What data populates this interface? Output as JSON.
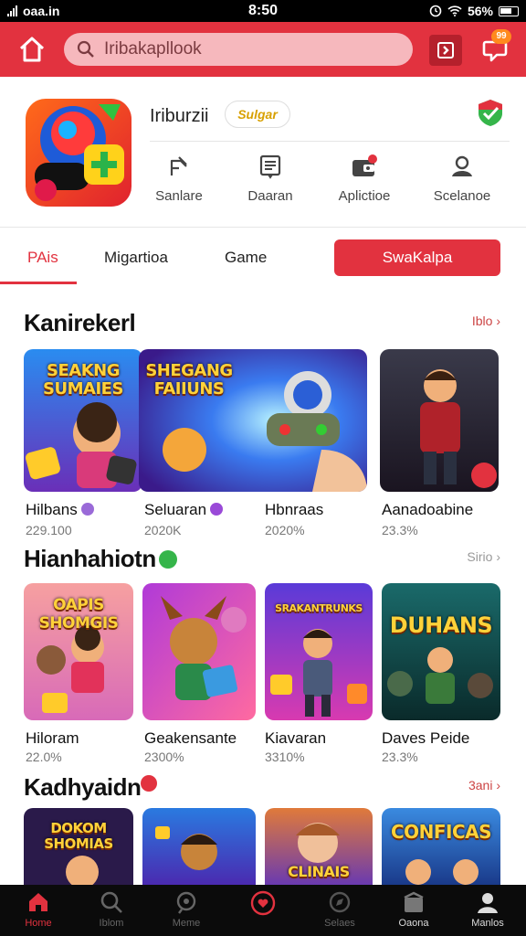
{
  "status_bar": {
    "carrier": "oaa.in",
    "time": "8:50",
    "battery": "56%"
  },
  "app_bar": {
    "search_placeholder": "Iribakapllook",
    "notification_count": "99"
  },
  "app_header": {
    "name": "Iriburzii",
    "badge": "Sulgar",
    "quick_actions": [
      {
        "label": "Sanlare",
        "icon": "share-icon"
      },
      {
        "label": "Daaran",
        "icon": "document-icon"
      },
      {
        "label": "Aplictioe",
        "icon": "wallet-icon"
      },
      {
        "label": "Scelanoe",
        "icon": "profile-icon"
      }
    ]
  },
  "tabs": {
    "items": [
      "PAis",
      "Migartioa",
      "Game"
    ],
    "active_index": 0,
    "subscribe_label": "SwaKalpa"
  },
  "sections": [
    {
      "title": "Kanirekerl",
      "link": "Iblo",
      "cards": [
        {
          "title": "Hilbans",
          "meta": "229.100",
          "cover": "SEAKNG SUMAIES",
          "verified": true
        },
        {
          "title": "Seluaran",
          "meta": "2020K",
          "cover": "SHEGANG FAIIUNS",
          "verified": true
        },
        {
          "title": "Hbnraas",
          "meta": "2020%",
          "cover": "",
          "verified": false
        },
        {
          "title": "Aanadoabine",
          "meta": "23.3%",
          "cover": "",
          "verified": false
        }
      ]
    },
    {
      "title": "Hianhahiotn",
      "link": "Sirio",
      "cards": [
        {
          "title": "Hiloram",
          "meta": "22.0%",
          "cover": "OAPIS SHOMGIS"
        },
        {
          "title": "Geakensante",
          "meta": "2300%",
          "cover": ""
        },
        {
          "title": "Kiavaran",
          "meta": "3310%",
          "cover": "SRAKANTRUNKS"
        },
        {
          "title": "Daves Peide",
          "meta": "23.3%",
          "cover": "DUHANS"
        }
      ]
    },
    {
      "title": "Kadhyaidn",
      "link": "3ani",
      "cards": [
        {
          "cover": "DOKOM SHOMIAS"
        },
        {
          "cover": ""
        },
        {
          "cover": "CLINAIS"
        },
        {
          "cover": "CONFICAS"
        }
      ]
    }
  ],
  "bottom_nav": [
    {
      "label": "Home",
      "icon": "home-icon"
    },
    {
      "label": "Iblom",
      "icon": "search-icon"
    },
    {
      "label": "Meme",
      "icon": "chat-icon"
    },
    {
      "label": "",
      "icon": "heart-icon"
    },
    {
      "label": "Selaes",
      "icon": "explore-icon"
    },
    {
      "label": "Oaona",
      "icon": "store-icon"
    },
    {
      "label": "Manlos",
      "icon": "profile-icon"
    }
  ],
  "colors": {
    "accent": "#e2323f",
    "search_bg": "#f6b8bd",
    "nav_bg": "#0b0b0b"
  }
}
